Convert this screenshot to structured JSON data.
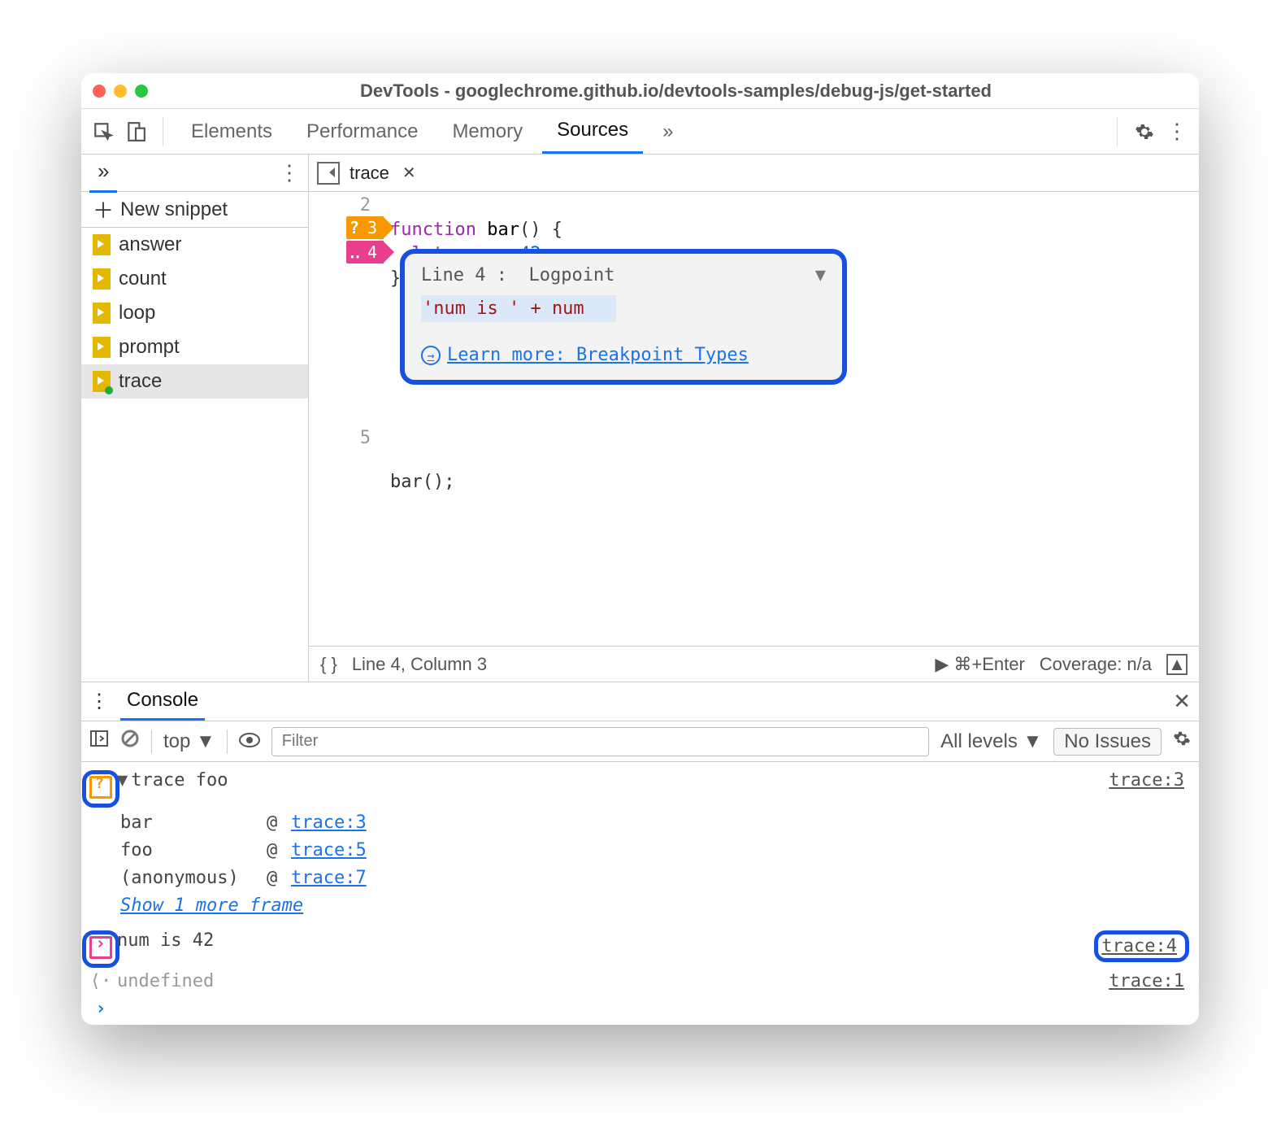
{
  "title": "DevTools - googlechrome.github.io/devtools-samples/debug-js/get-started",
  "tabs": [
    "Elements",
    "Performance",
    "Memory",
    "Sources"
  ],
  "active_tab": "Sources",
  "more_tabs": "»",
  "sidebar": {
    "dd": "»",
    "new_snippet": "New snippet",
    "snippets": [
      "answer",
      "count",
      "loop",
      "prompt",
      "trace"
    ],
    "selected": "trace"
  },
  "editor": {
    "filename": "trace",
    "lines": {
      "l2": "2",
      "l3": "3",
      "l4": "4",
      "l5": "5"
    },
    "code": {
      "l2a": "function",
      "l2b": " bar",
      "l2c": "() {",
      "l3a": "  let",
      "l3b": " num = ",
      "l3c": "42",
      "l3d": ";",
      "l4": "}",
      "l5": "bar();"
    },
    "popup": {
      "head_line": "Line 4 :",
      "head_type": "Logpoint",
      "expr": "'num is ' + num",
      "link": "Learn more: Breakpoint Types"
    },
    "status": {
      "braces": "{ }",
      "pos": "Line 4, Column 3",
      "run": "▶ ⌘+Enter",
      "cov": "Coverage: n/a"
    }
  },
  "console": {
    "tab": "Console",
    "toolbar": {
      "context": "top ▼",
      "filter_ph": "Filter",
      "levels": "All levels ▼",
      "issues": "No Issues"
    },
    "rows": {
      "trace_hdr": "trace foo",
      "trace_hdr_loc": "trace:3",
      "frames": [
        {
          "fn": "bar",
          "loc": "trace:3"
        },
        {
          "fn": "foo",
          "loc": "trace:5"
        },
        {
          "fn": "(anonymous)",
          "loc": "trace:7"
        }
      ],
      "show_more": "Show 1 more frame",
      "log_msg": "num is 42",
      "log_loc": "trace:4",
      "undef": "undefined",
      "undef_loc": "trace:1"
    }
  }
}
